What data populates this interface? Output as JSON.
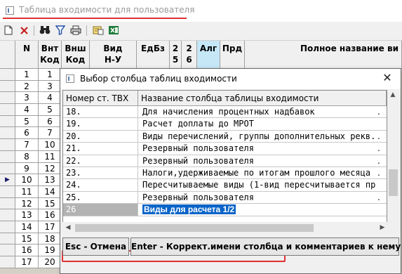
{
  "window": {
    "title": "Таблица входимости для  пользователя"
  },
  "toolbar": {
    "icons": [
      "new-document-icon",
      "delete-icon",
      "binoculars-icon",
      "filter-icon",
      "print-icon",
      "export-icon",
      "excel-icon"
    ]
  },
  "grid": {
    "headers": [
      "N",
      "Внт\nКод",
      "Внш\nКод",
      "Вид\nН-У",
      "ЕдБз",
      "2\n5",
      "2\n6",
      "Алг",
      "Прд",
      "Полное название ви"
    ],
    "selected_header": "Алг",
    "row_numbers": [
      "1",
      "2",
      "3",
      "4",
      "5",
      "6",
      "7",
      "8",
      "9",
      "10",
      "11",
      "12",
      "13",
      "14",
      "15",
      "16",
      "17"
    ],
    "internal_codes": [
      "1",
      "3",
      "4",
      "5",
      "6",
      "7",
      "10",
      "11",
      "12",
      "13",
      "14",
      "15",
      "16",
      "17",
      "18",
      "19",
      "20"
    ],
    "current_row_marker": "▶"
  },
  "dialog": {
    "title": "Выбор столбца таблиц входимости",
    "close_symbol": "✕",
    "columns": [
      "Номер ст. ТВХ",
      "Название столбца таблицы входимости"
    ],
    "rows": [
      {
        "num": "18.",
        "name": "Для начисления процентных надбавок",
        "mark": "."
      },
      {
        "num": "19.",
        "name": "Расчет доплаты до МРОТ",
        "mark": ""
      },
      {
        "num": "20.",
        "name": "Виды перечислений, группы дополнительных рекв.",
        "mark": "."
      },
      {
        "num": "21.",
        "name": "Резервный пользователя",
        "mark": "."
      },
      {
        "num": "22.",
        "name": "Резервный пользователя",
        "mark": "."
      },
      {
        "num": "23.",
        "name": "Налоги,удерживаемые по итогам прошлого месяца",
        "mark": "."
      },
      {
        "num": "24.",
        "name": "Пересчитываемые виды (1-вид пересчитывается пр",
        "mark": ""
      },
      {
        "num": "25.",
        "name": "Резервный пользователя",
        "mark": "."
      },
      {
        "num": "26",
        "name": "Виды для расчета 1/2",
        "mark": ""
      }
    ],
    "selected_row": 8,
    "buttons": {
      "cancel": "Esc - Отмена",
      "rename": "Enter - Коррект.имени столбца и комментариев к нему"
    }
  }
}
